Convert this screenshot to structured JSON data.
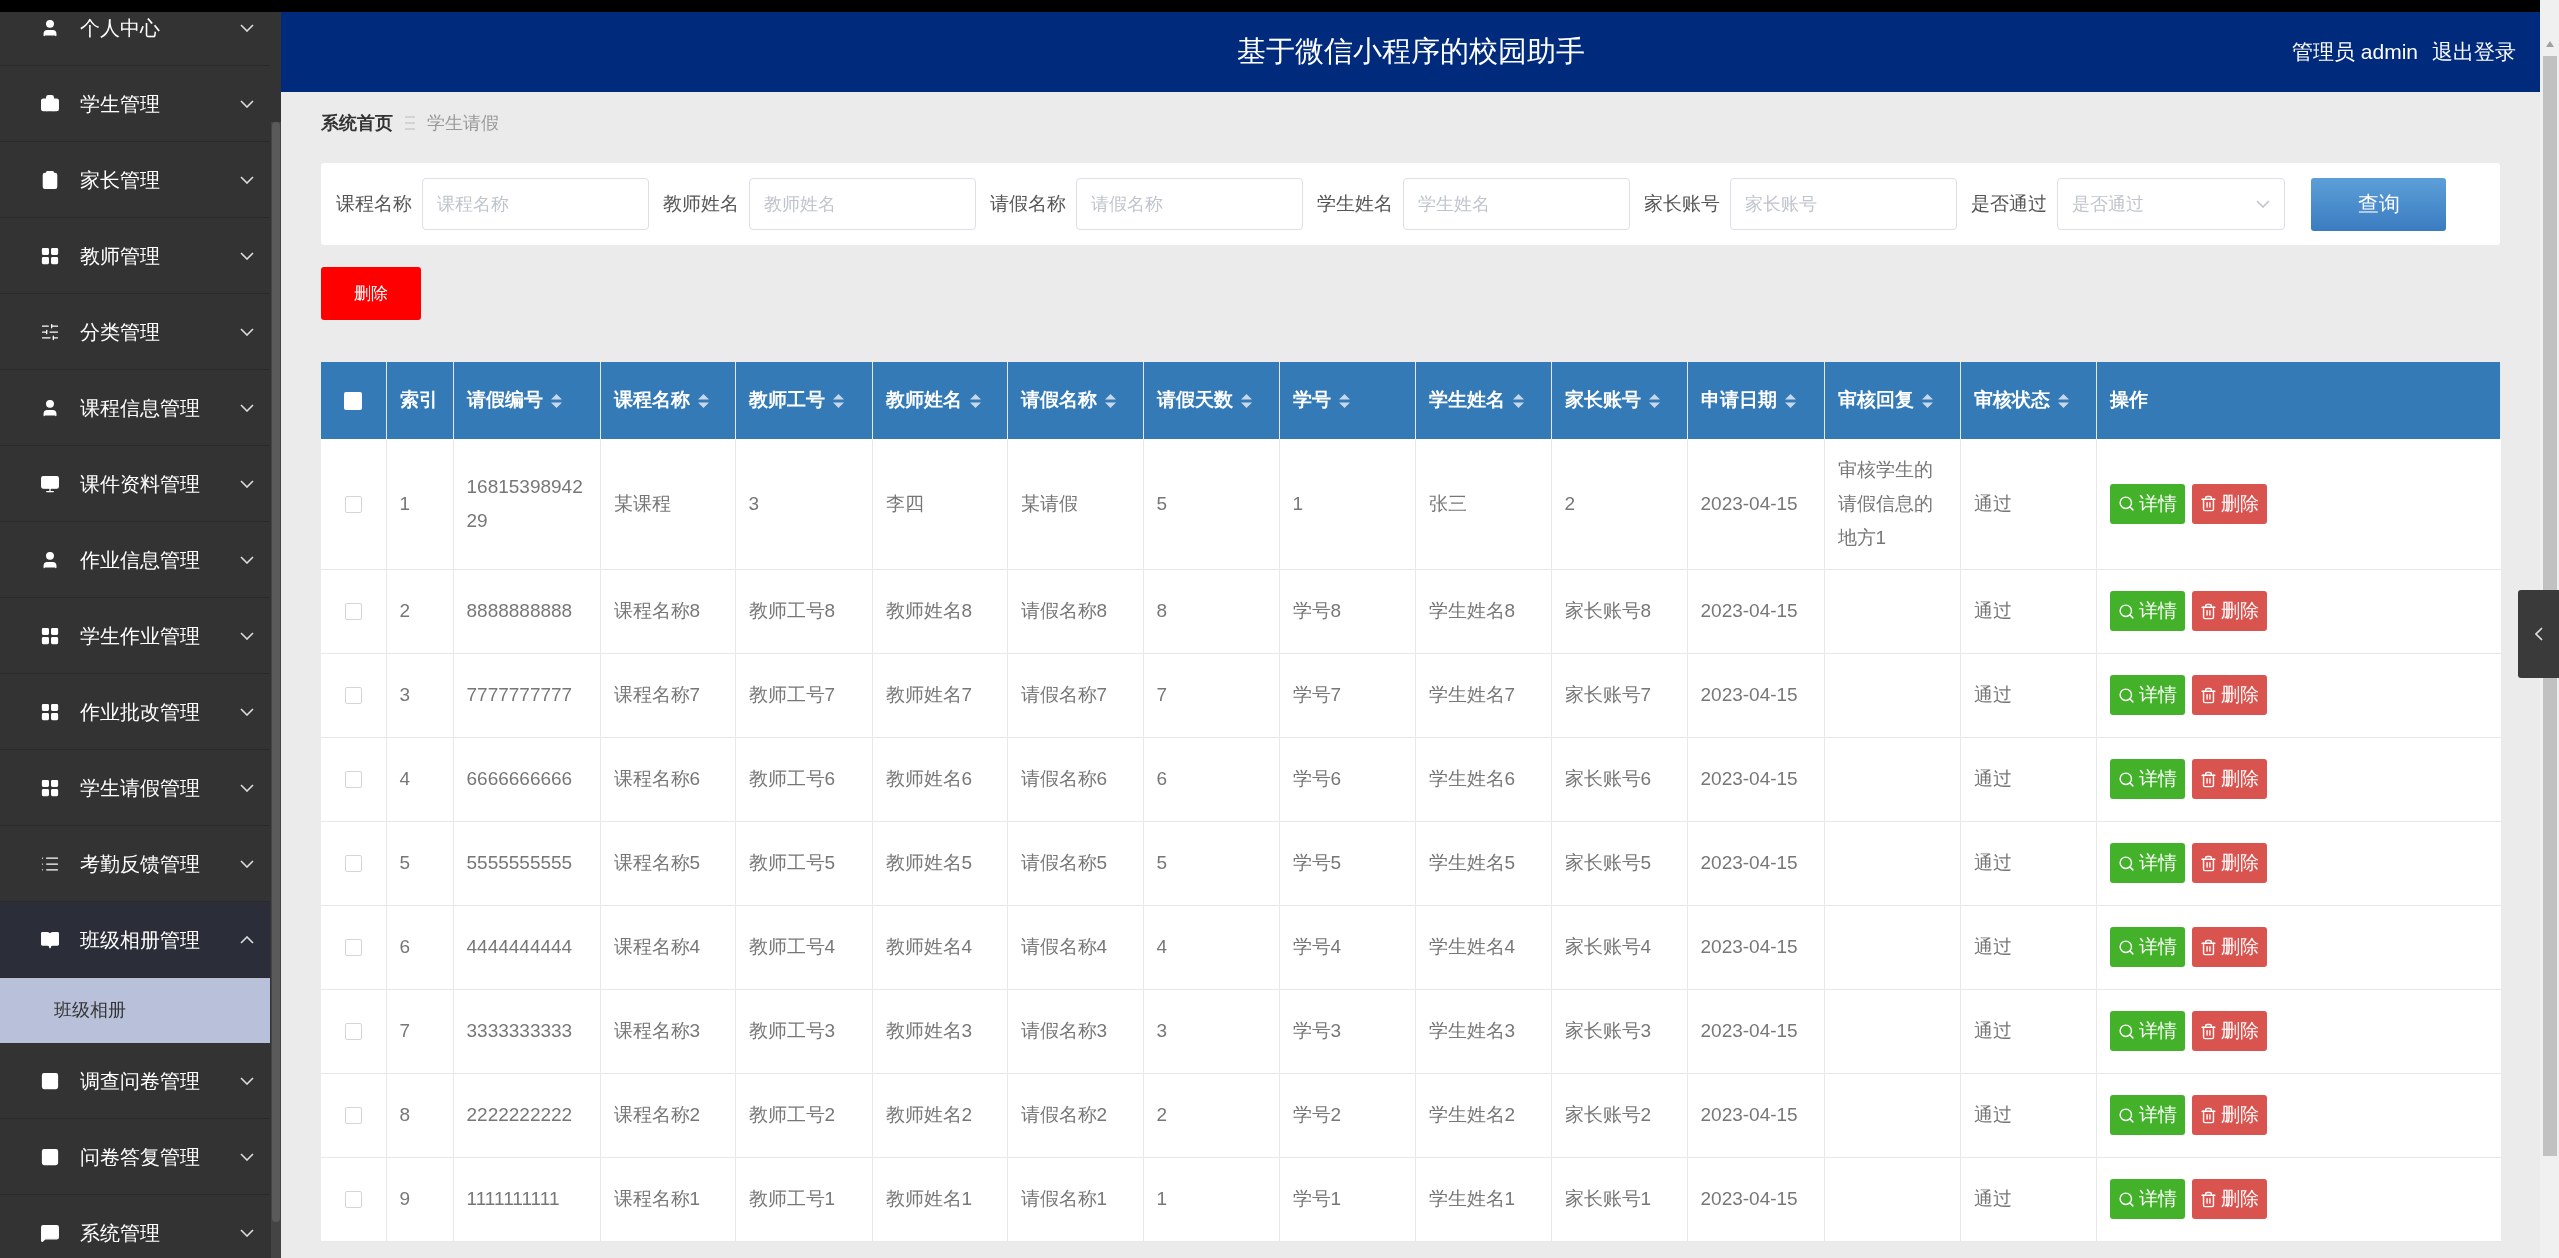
{
  "sidebar": {
    "items": [
      {
        "label": "个人中心",
        "expanded": false
      },
      {
        "label": "学生管理",
        "expanded": false
      },
      {
        "label": "家长管理",
        "expanded": false
      },
      {
        "label": "教师管理",
        "expanded": false
      },
      {
        "label": "分类管理",
        "expanded": false
      },
      {
        "label": "课程信息管理",
        "expanded": false
      },
      {
        "label": "课件资料管理",
        "expanded": false
      },
      {
        "label": "作业信息管理",
        "expanded": false
      },
      {
        "label": "学生作业管理",
        "expanded": false
      },
      {
        "label": "作业批改管理",
        "expanded": false
      },
      {
        "label": "学生请假管理",
        "expanded": false
      },
      {
        "label": "考勤反馈管理",
        "expanded": false
      },
      {
        "label": "班级相册管理",
        "expanded": true,
        "children": [
          {
            "label": "班级相册",
            "selected": true
          }
        ]
      },
      {
        "label": "调查问卷管理",
        "expanded": false
      },
      {
        "label": "问卷答复管理",
        "expanded": false
      },
      {
        "label": "系统管理",
        "expanded": false
      }
    ]
  },
  "header": {
    "title": "基于微信小程序的校园助手",
    "user": "管理员 admin",
    "logout": "退出登录"
  },
  "breadcrumb": [
    "系统首页",
    "学生请假"
  ],
  "search": {
    "fields": [
      {
        "label": "课程名称",
        "placeholder": "课程名称",
        "kind": "input"
      },
      {
        "label": "教师姓名",
        "placeholder": "教师姓名",
        "kind": "input"
      },
      {
        "label": "请假名称",
        "placeholder": "请假名称",
        "kind": "input"
      },
      {
        "label": "学生姓名",
        "placeholder": "学生姓名",
        "kind": "input"
      },
      {
        "label": "家长账号",
        "placeholder": "家长账号",
        "kind": "input"
      },
      {
        "label": "是否通过",
        "placeholder": "是否通过",
        "kind": "select"
      }
    ],
    "button": "查询"
  },
  "delete_button": "删除",
  "table": {
    "all_checked": false,
    "columns": [
      {
        "label": "索引",
        "sortable": false
      },
      {
        "label": "请假编号",
        "sortable": true
      },
      {
        "label": "课程名称",
        "sortable": true
      },
      {
        "label": "教师工号",
        "sortable": true
      },
      {
        "label": "教师姓名",
        "sortable": true
      },
      {
        "label": "请假名称",
        "sortable": true
      },
      {
        "label": "请假天数",
        "sortable": true
      },
      {
        "label": "学号",
        "sortable": true
      },
      {
        "label": "学生姓名",
        "sortable": true
      },
      {
        "label": "家长账号",
        "sortable": true
      },
      {
        "label": "申请日期",
        "sortable": true
      },
      {
        "label": "审核回复",
        "sortable": true
      },
      {
        "label": "审核状态",
        "sortable": true
      },
      {
        "label": "操作",
        "sortable": false
      }
    ],
    "rows": [
      {
        "checked": false,
        "cells": [
          "1",
          "1681539894229",
          "某课程",
          "3",
          "李四",
          "某请假",
          "5",
          "1",
          "张三",
          "2",
          "2023-04-15",
          "审核学生的请假信息的地方1",
          "通过"
        ],
        "actions": [
          {
            "label": "详情",
            "kind": "detail"
          },
          {
            "label": "删除",
            "kind": "delete"
          }
        ]
      },
      {
        "checked": false,
        "cells": [
          "2",
          "8888888888",
          "课程名称8",
          "教师工号8",
          "教师姓名8",
          "请假名称8",
          "8",
          "学号8",
          "学生姓名8",
          "家长账号8",
          "2023-04-15",
          "",
          "通过"
        ],
        "actions": [
          {
            "label": "详情",
            "kind": "detail"
          },
          {
            "label": "删除",
            "kind": "delete"
          }
        ]
      },
      {
        "checked": false,
        "cells": [
          "3",
          "7777777777",
          "课程名称7",
          "教师工号7",
          "教师姓名7",
          "请假名称7",
          "7",
          "学号7",
          "学生姓名7",
          "家长账号7",
          "2023-04-15",
          "",
          "通过"
        ],
        "actions": [
          {
            "label": "详情",
            "kind": "detail"
          },
          {
            "label": "删除",
            "kind": "delete"
          }
        ]
      },
      {
        "checked": false,
        "cells": [
          "4",
          "6666666666",
          "课程名称6",
          "教师工号6",
          "教师姓名6",
          "请假名称6",
          "6",
          "学号6",
          "学生姓名6",
          "家长账号6",
          "2023-04-15",
          "",
          "通过"
        ],
        "actions": [
          {
            "label": "详情",
            "kind": "detail"
          },
          {
            "label": "删除",
            "kind": "delete"
          }
        ]
      },
      {
        "checked": false,
        "cells": [
          "5",
          "5555555555",
          "课程名称5",
          "教师工号5",
          "教师姓名5",
          "请假名称5",
          "5",
          "学号5",
          "学生姓名5",
          "家长账号5",
          "2023-04-15",
          "",
          "通过"
        ],
        "actions": [
          {
            "label": "详情",
            "kind": "detail"
          },
          {
            "label": "删除",
            "kind": "delete"
          }
        ]
      },
      {
        "checked": false,
        "cells": [
          "6",
          "4444444444",
          "课程名称4",
          "教师工号4",
          "教师姓名4",
          "请假名称4",
          "4",
          "学号4",
          "学生姓名4",
          "家长账号4",
          "2023-04-15",
          "",
          "通过"
        ],
        "actions": [
          {
            "label": "详情",
            "kind": "detail"
          },
          {
            "label": "删除",
            "kind": "delete"
          }
        ]
      },
      {
        "checked": false,
        "cells": [
          "7",
          "3333333333",
          "课程名称3",
          "教师工号3",
          "教师姓名3",
          "请假名称3",
          "3",
          "学号3",
          "学生姓名3",
          "家长账号3",
          "2023-04-15",
          "",
          "通过"
        ],
        "actions": [
          {
            "label": "详情",
            "kind": "detail"
          },
          {
            "label": "删除",
            "kind": "delete"
          }
        ]
      },
      {
        "checked": false,
        "cells": [
          "8",
          "2222222222",
          "课程名称2",
          "教师工号2",
          "教师姓名2",
          "请假名称2",
          "2",
          "学号2",
          "学生姓名2",
          "家长账号2",
          "2023-04-15",
          "",
          "通过"
        ],
        "actions": [
          {
            "label": "详情",
            "kind": "detail"
          },
          {
            "label": "删除",
            "kind": "delete"
          }
        ]
      },
      {
        "checked": false,
        "cells": [
          "9",
          "1111111111",
          "课程名称1",
          "教师工号1",
          "教师姓名1",
          "请假名称1",
          "1",
          "学号1",
          "学生姓名1",
          "家长账号1",
          "2023-04-15",
          "",
          "通过"
        ],
        "actions": [
          {
            "label": "详情",
            "kind": "detail"
          },
          {
            "label": "删除",
            "kind": "delete"
          }
        ]
      }
    ]
  }
}
